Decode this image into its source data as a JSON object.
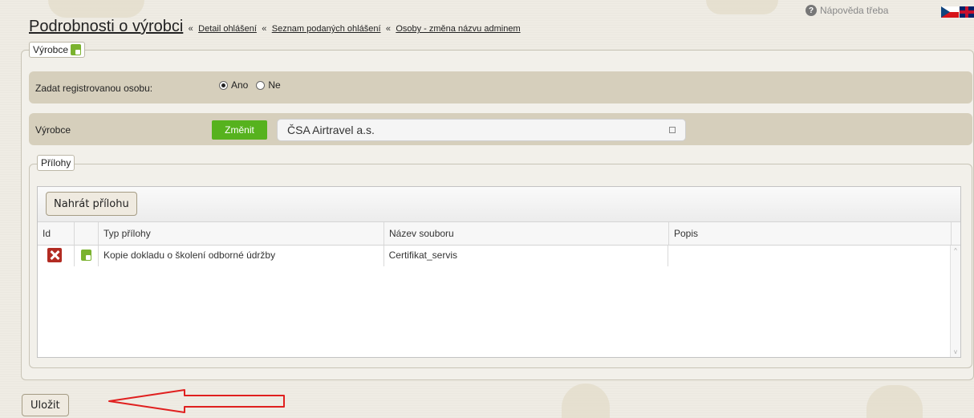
{
  "header": {
    "help_label": "Nápověda třeba",
    "title": "Podrobnosti o výrobci",
    "separator": "«",
    "breadcrumbs": [
      "Detail ohlášení",
      "Seznam podaných ohlášení",
      "Osoby - změna názvu adminem"
    ]
  },
  "manufacturer_section": {
    "legend": "Výrobce",
    "registered_person_label": "Zadat registrovanou osobu:",
    "radio_yes": "Ano",
    "radio_no": "Ne",
    "radio_selected": "Ano",
    "manufacturer_label": "Výrobce",
    "change_button": "Změnit",
    "manufacturer_value": "ČSA Airtravel a.s."
  },
  "attachments": {
    "legend": "Přílohy",
    "upload_button": "Nahrát přílohu",
    "columns": [
      "Id",
      "",
      "Typ přílohy",
      "Název souboru",
      "Popis"
    ],
    "rows": [
      {
        "type": "Kopie dokladu o školení odborné údržby",
        "file_name": "Certifikat_servis",
        "description": ""
      }
    ]
  },
  "footer": {
    "save_button": "Uložit"
  },
  "colors": {
    "accent_green": "#56b21e",
    "band": "#d6cfbc",
    "annotation_arrow": "#e0201f"
  }
}
